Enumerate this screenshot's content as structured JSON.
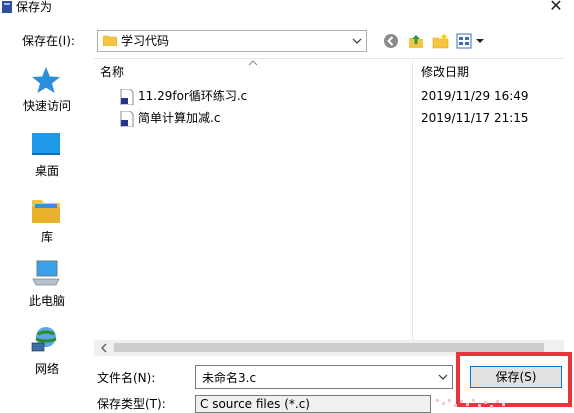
{
  "window": {
    "title": "保存为",
    "close_label": "✕"
  },
  "location": {
    "label": "保存在(I):",
    "current_folder": "学习代码"
  },
  "places": [
    {
      "label": "快速访问",
      "icon": "star-icon"
    },
    {
      "label": "桌面",
      "icon": "desktop-icon"
    },
    {
      "label": "库",
      "icon": "library-icon"
    },
    {
      "label": "此电脑",
      "icon": "computer-icon"
    },
    {
      "label": "网络",
      "icon": "network-icon"
    }
  ],
  "file_list": {
    "columns": {
      "name": "名称",
      "modified": "修改日期"
    },
    "files": [
      {
        "name": "11.29for循环练习.c",
        "modified": "2019/11/29 16:49"
      },
      {
        "name": "简单计算加减.c",
        "modified": "2019/11/17 21:15"
      }
    ]
  },
  "form": {
    "filename_label": "文件名(N):",
    "filename_value": "未命名3.c",
    "filetype_label": "保存类型(T):",
    "filetype_value": "C source files (*.c)",
    "save_button": "保存(S)"
  },
  "colors": {
    "highlight": "#e8353b",
    "accent": "#0078d7",
    "folder": "#f5c542",
    "places_icon": "#2b8fd9"
  }
}
